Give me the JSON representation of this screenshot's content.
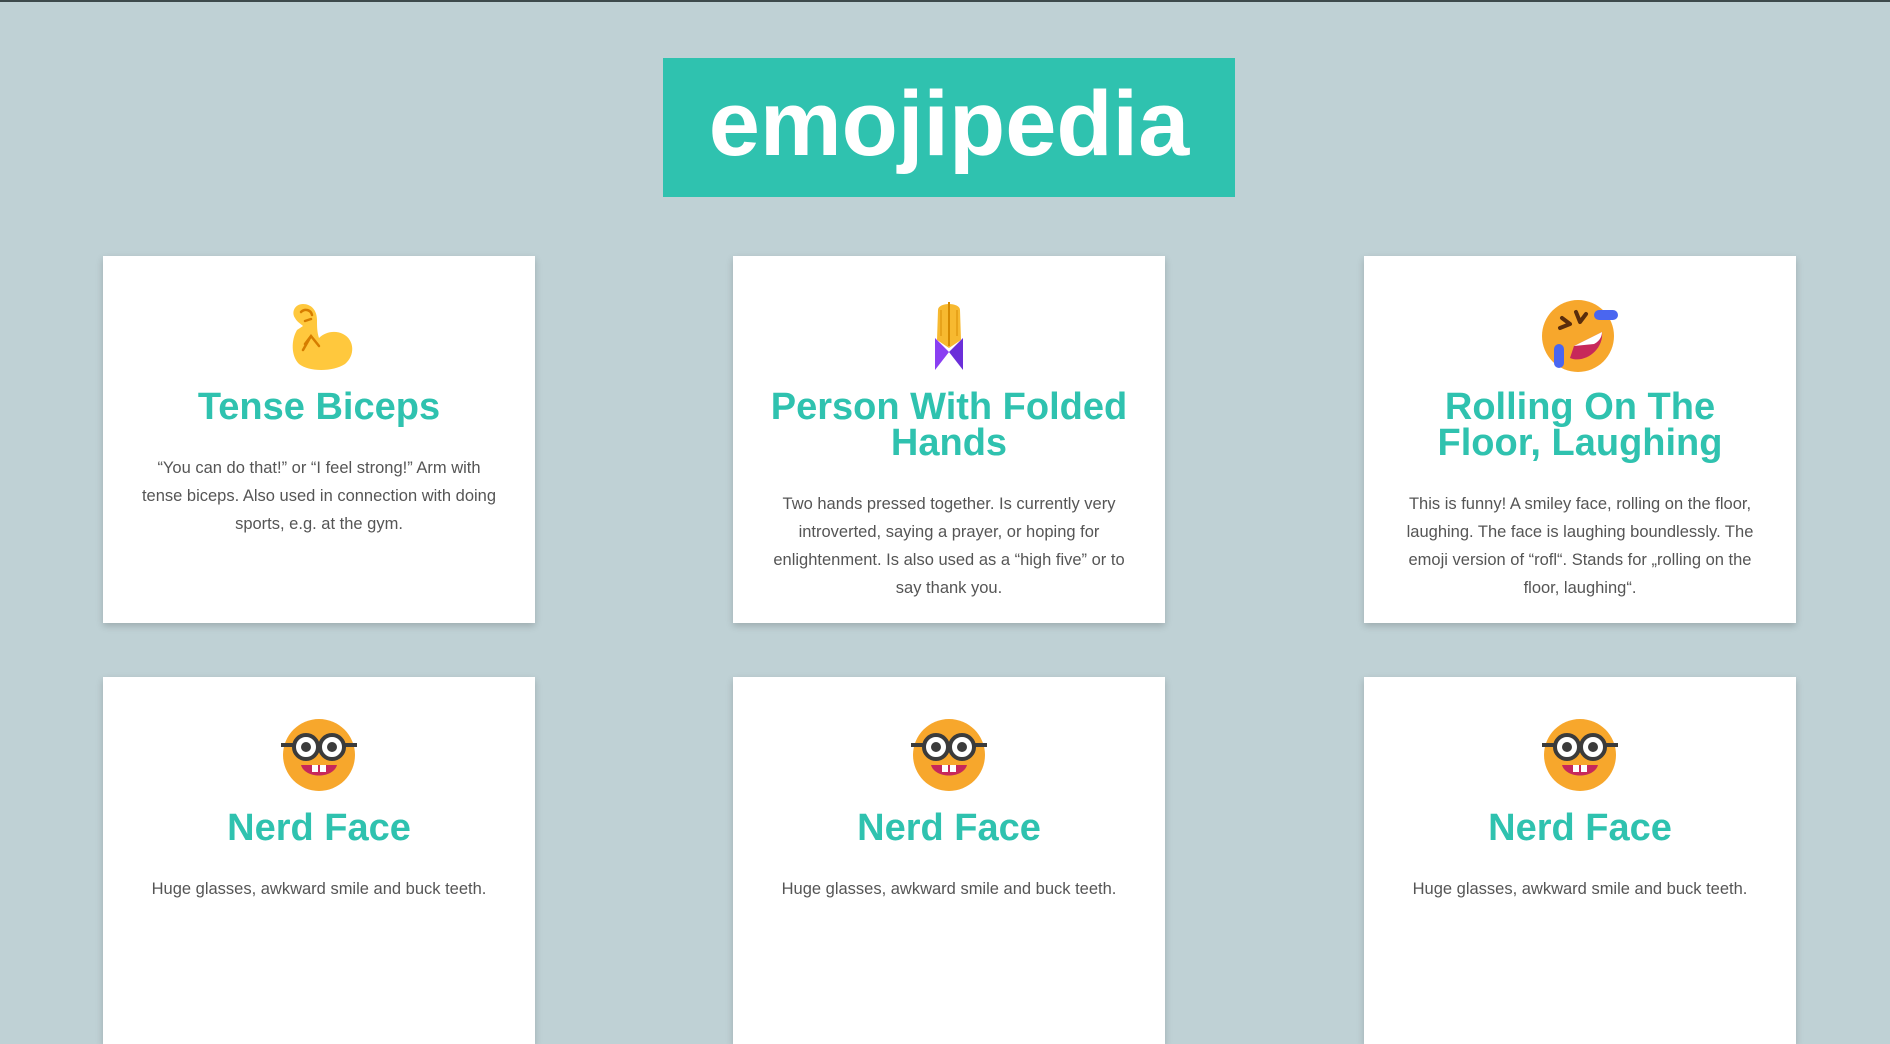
{
  "header": {
    "title": "emojipedia"
  },
  "cards": [
    {
      "icon": "tense-biceps-icon",
      "title": "Tense Biceps",
      "description": "“You can do that!” or “I feel strong!” Arm with tense biceps. Also used in connection with doing sports, e.g. at the gym."
    },
    {
      "icon": "folded-hands-icon",
      "title": "Person With Folded Hands",
      "description": "Two hands pressed together. Is currently very introverted, saying a prayer, or hoping for enlightenment. Is also used as a “high five” or to say thank you."
    },
    {
      "icon": "rolling-on-floor-laughing-icon",
      "title": "Rolling On The Floor, Laughing",
      "description": "This is funny! A smiley face, rolling on the floor, laughing. The face is laughing boundlessly. The emoji version of “rofl“. Stands for „rolling on the floor, laughing“."
    },
    {
      "icon": "nerd-face-icon",
      "title": "Nerd Face",
      "description": "Huge glasses, awkward smile and buck teeth."
    },
    {
      "icon": "nerd-face-icon",
      "title": "Nerd Face",
      "description": "Huge glasses, awkward smile and buck teeth."
    },
    {
      "icon": "nerd-face-icon",
      "title": "Nerd Face",
      "description": "Huge glasses, awkward smile and buck teeth."
    }
  ],
  "colors": {
    "background": "#bfd1d5",
    "accent": "#2fc2af",
    "card": "#ffffff",
    "text": "#555555"
  }
}
